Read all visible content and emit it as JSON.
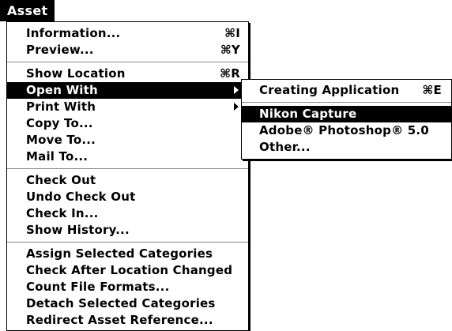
{
  "menubar": {
    "title": "Asset"
  },
  "main_menu": {
    "groups": [
      [
        {
          "label": "Information...",
          "shortcut": "⌘I"
        },
        {
          "label": "Preview...",
          "shortcut": "⌘Y"
        }
      ],
      [
        {
          "label": "Show Location",
          "shortcut": "⌘R"
        },
        {
          "label": "Open With",
          "submenu": true,
          "highlighted": true
        },
        {
          "label": "Print With",
          "submenu": true
        },
        {
          "label": "Copy To..."
        },
        {
          "label": "Move To..."
        },
        {
          "label": "Mail To..."
        }
      ],
      [
        {
          "label": "Check Out"
        },
        {
          "label": "Undo Check Out"
        },
        {
          "label": "Check In..."
        },
        {
          "label": "Show History..."
        }
      ],
      [
        {
          "label": "Assign Selected Categories"
        },
        {
          "label": "Check After Location Changed"
        },
        {
          "label": "Count File Formats..."
        },
        {
          "label": "Detach Selected Categories"
        },
        {
          "label": "Redirect Asset Reference..."
        }
      ]
    ]
  },
  "submenu_open_with": {
    "groups": [
      [
        {
          "label": "Creating Application",
          "shortcut": "⌘E"
        }
      ],
      [
        {
          "label": "Nikon Capture",
          "highlighted": true
        },
        {
          "label": "Adobe® Photoshop® 5.0"
        },
        {
          "label": "Other..."
        }
      ]
    ]
  }
}
